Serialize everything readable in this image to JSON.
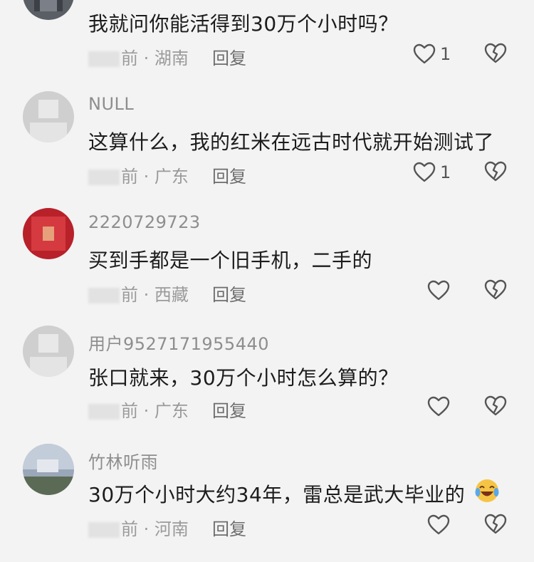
{
  "comments": [
    {
      "username": "",
      "text": "我就问你能活得到30万个小时吗？",
      "time_suffix": "前",
      "location": "湖南",
      "reply": "回复",
      "likes": "1"
    },
    {
      "username": "NULL",
      "text": "这算什么，我的红米在远古时代就开始测试了",
      "time_suffix": "前",
      "location": "广东",
      "reply": "回复",
      "likes": "1"
    },
    {
      "username": "2220729723",
      "text": "买到手都是一个旧手机，二手的",
      "time_suffix": "前",
      "location": "西藏",
      "reply": "回复",
      "likes": ""
    },
    {
      "username": "用户9527171955440",
      "text": "张口就来，30万个小时怎么算的？",
      "time_suffix": "前",
      "location": "广东",
      "reply": "回复",
      "likes": ""
    },
    {
      "username": "竹林听雨",
      "text": "30万个小时大约34年，雷总是武大毕业的",
      "time_suffix": "前",
      "location": "河南",
      "reply": "回复",
      "likes": ""
    }
  ],
  "icons": {
    "like": "heart-outline-icon",
    "dislike": "broken-heart-icon",
    "emoji": "laughing-crying-emoji-icon"
  },
  "colors": {
    "background": "#f3f3f3",
    "text": "#1c1c1c",
    "muted": "#9a9a9a",
    "icon": "#555555"
  }
}
